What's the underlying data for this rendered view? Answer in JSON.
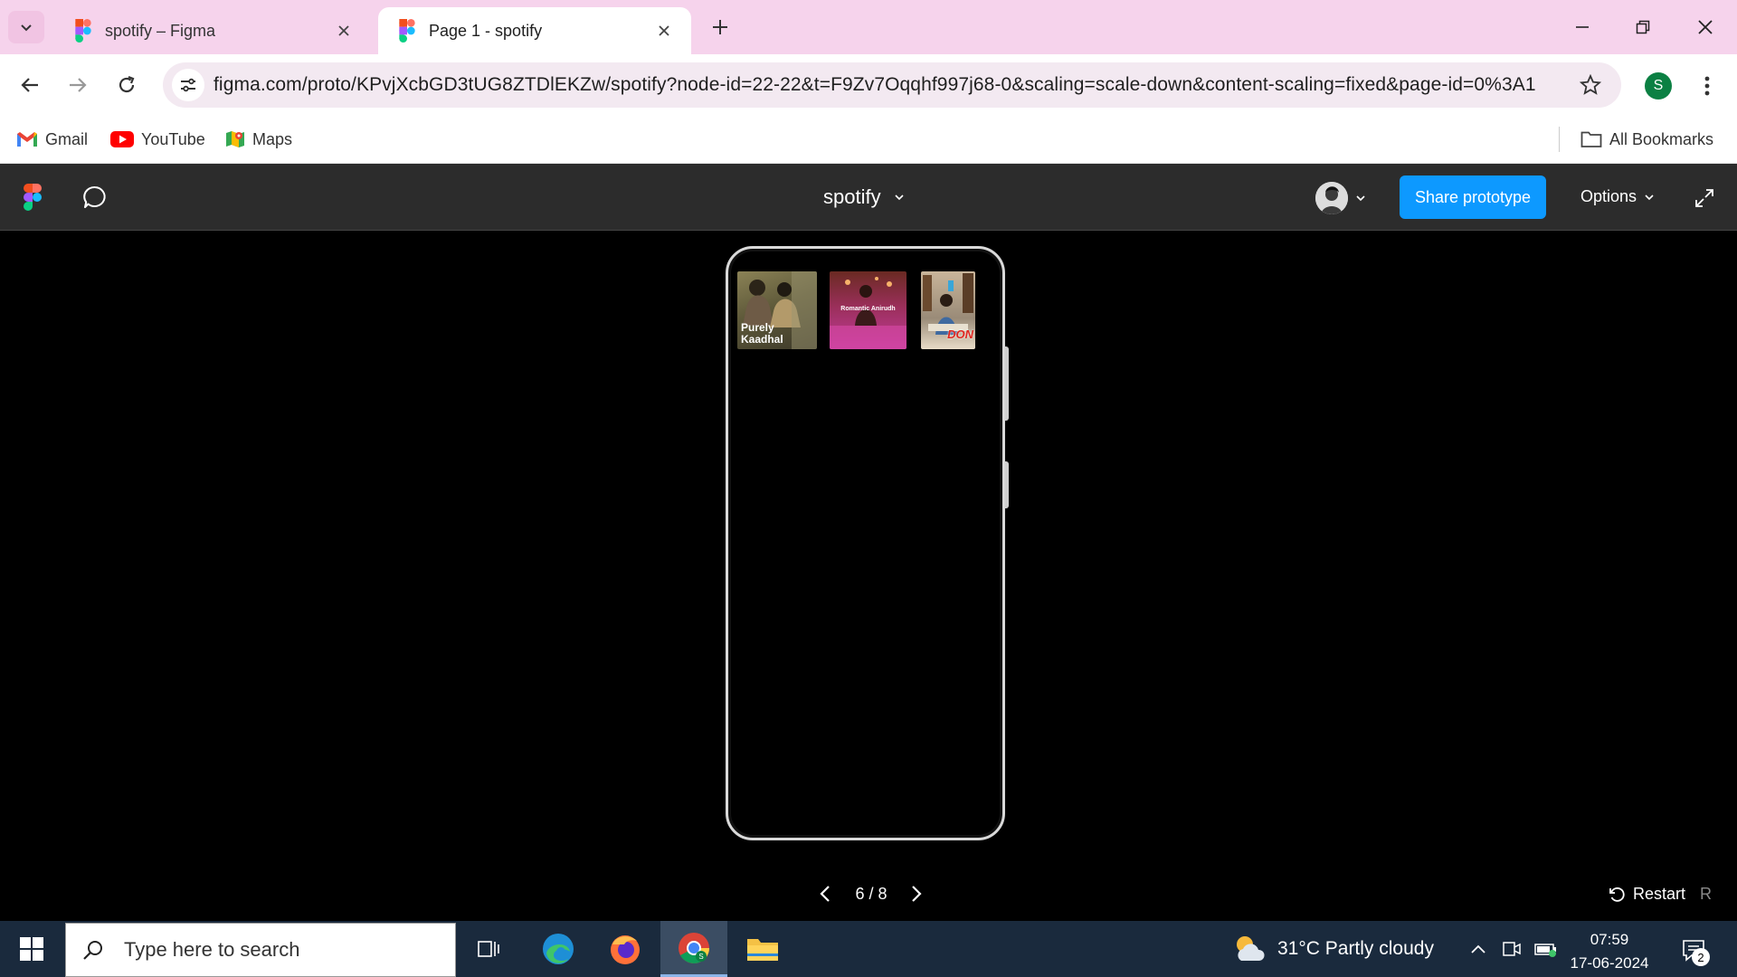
{
  "browser": {
    "tabs": [
      {
        "title": "spotify – Figma",
        "active": false
      },
      {
        "title": "Page 1 - spotify",
        "active": true
      }
    ],
    "url": "figma.com/proto/KPvjXcbGD3tUG8ZTDlEKZw/spotify?node-id=22-22&t=F9Zv7Oqqhf997j68-0&scaling=scale-down&content-scaling=fixed&page-id=0%3A1",
    "profile_initial": "S",
    "bookmarks": [
      {
        "label": "Gmail",
        "icon": "gmail-icon"
      },
      {
        "label": "YouTube",
        "icon": "youtube-icon"
      },
      {
        "label": "Maps",
        "icon": "maps-icon"
      }
    ],
    "all_bookmarks_label": "All Bookmarks"
  },
  "figma": {
    "file_title": "spotify",
    "share_label": "Share prototype",
    "options_label": "Options",
    "page_counter": "6 / 8",
    "restart_label": "Restart",
    "restart_key": "R",
    "accent_color": "#0d99ff"
  },
  "prototype": {
    "albums": [
      {
        "label": "Purely Kaadhal"
      },
      {
        "label": "Romantic Anirudh"
      },
      {
        "label": "DON"
      }
    ]
  },
  "taskbar": {
    "search_placeholder": "Type here to search",
    "weather": "31°C  Partly cloudy",
    "time": "07:59",
    "date": "17-06-2024",
    "notification_count": "2"
  }
}
